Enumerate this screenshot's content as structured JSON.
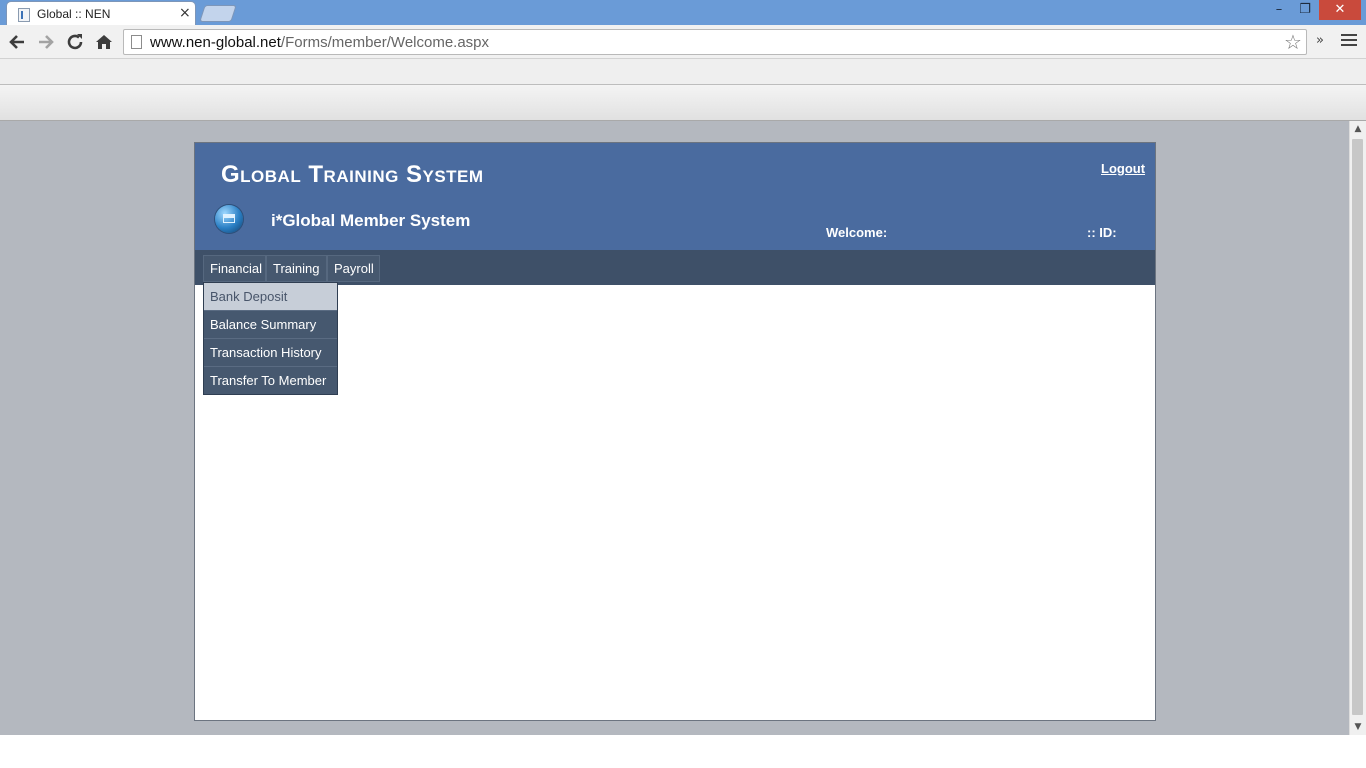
{
  "browser": {
    "tab_title": "Global :: NEN",
    "tab_close": "×",
    "url_host": "www.nen-global.net",
    "url_path": "/Forms/member/Welcome.aspx",
    "window_buttons": {
      "minimize": "–",
      "maximize": "❐",
      "close": "✕"
    },
    "icons": [
      "back-icon",
      "forward-icon",
      "reload-icon",
      "home-icon",
      "star-icon",
      "chevron-more-icon",
      "menu-icon"
    ]
  },
  "site": {
    "title": "Global Training System",
    "subtitle": "i*Global Member System",
    "logout_label": "Logout",
    "welcome_label": "Welcome:",
    "id_label": ":: ID:",
    "nav": [
      {
        "label": "Financial"
      },
      {
        "label": "Training"
      },
      {
        "label": "Payroll"
      }
    ],
    "dropdown": [
      {
        "label": "Bank Deposit",
        "hovered": true
      },
      {
        "label": "Balance Summary"
      },
      {
        "label": "Transaction History"
      },
      {
        "label": "Transfer To Member"
      }
    ]
  },
  "colors": {
    "header_bg": "#4a6b9f",
    "nav_bg": "#3e5068",
    "menu_item_bg": "#46586f",
    "menu_hover_bg": "#c7ced8",
    "page_bg": "#b4b8bf"
  }
}
